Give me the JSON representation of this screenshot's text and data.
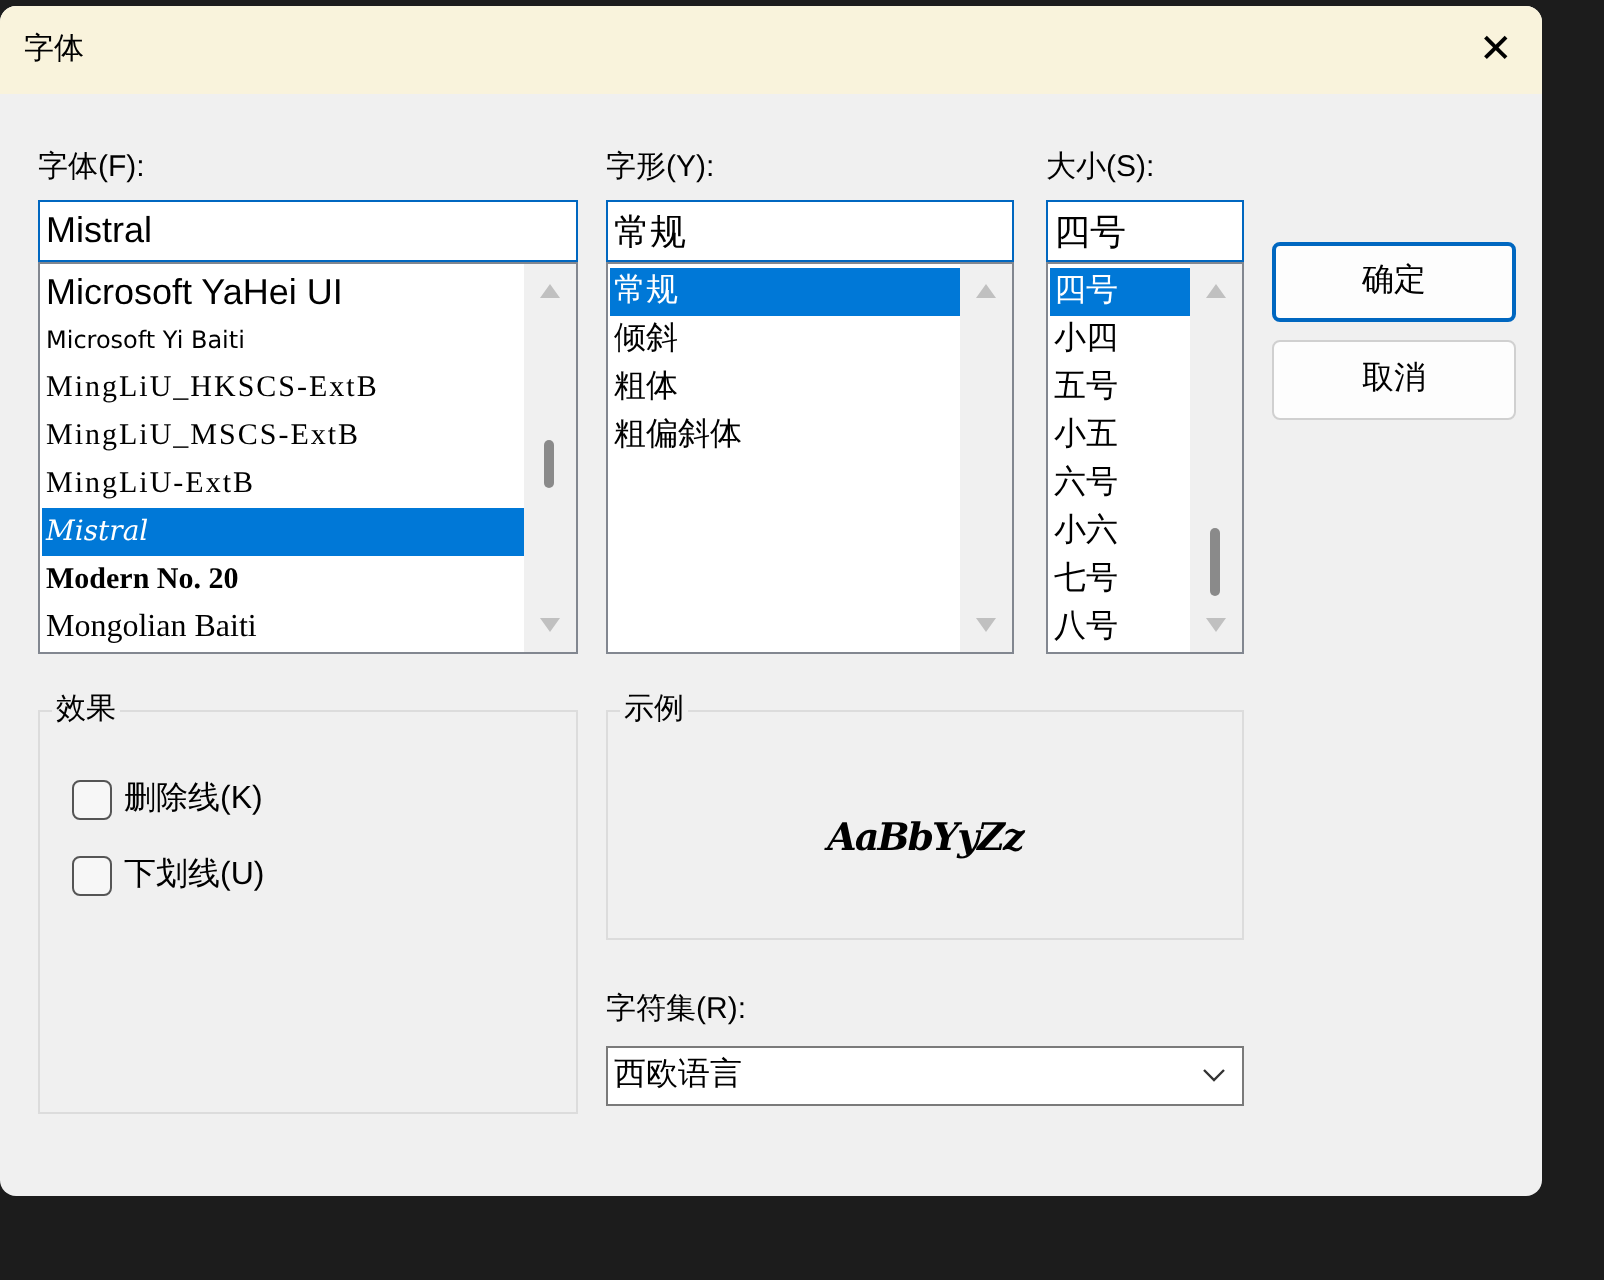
{
  "window": {
    "title": "字体",
    "close": "✕"
  },
  "font": {
    "label": "字体(F):",
    "value": "Mistral",
    "items": [
      {
        "label": "Microsoft YaHei UI",
        "kind": "sans",
        "selected": false
      },
      {
        "label": "Microsoft  Yi  Baiti",
        "kind": "small",
        "selected": false
      },
      {
        "label": "MingLiU_HKSCS-ExtB",
        "kind": "mono",
        "selected": false
      },
      {
        "label": "MingLiU_MSCS-ExtB",
        "kind": "mono",
        "selected": false
      },
      {
        "label": "MingLiU-ExtB",
        "kind": "mono",
        "selected": false
      },
      {
        "label": "Mistral",
        "kind": "script",
        "selected": true
      },
      {
        "label": "Modern No. 20",
        "kind": "bold",
        "selected": false
      },
      {
        "label": "Mongolian Baiti",
        "kind": "serif",
        "selected": false
      }
    ]
  },
  "style": {
    "label": "字形(Y):",
    "value": "常规",
    "items": [
      {
        "label": "常规",
        "selected": true
      },
      {
        "label": "倾斜",
        "selected": false
      },
      {
        "label": "粗体",
        "selected": false
      },
      {
        "label": "粗偏斜体",
        "selected": false
      }
    ]
  },
  "size": {
    "label": "大小(S):",
    "value": "四号",
    "items": [
      {
        "label": "四号",
        "selected": true
      },
      {
        "label": "小四",
        "selected": false
      },
      {
        "label": "五号",
        "selected": false
      },
      {
        "label": "小五",
        "selected": false
      },
      {
        "label": "六号",
        "selected": false
      },
      {
        "label": "小六",
        "selected": false
      },
      {
        "label": "七号",
        "selected": false
      },
      {
        "label": "八号",
        "selected": false
      }
    ]
  },
  "buttons": [
    {
      "label": "确定",
      "default": true
    },
    {
      "label": "取消",
      "default": false
    }
  ],
  "effects": {
    "title": "效果",
    "options": [
      {
        "label": "删除线(K)",
        "checked": false
      },
      {
        "label": "下划线(U)",
        "checked": false
      }
    ]
  },
  "sample": {
    "title": "示例",
    "text": "AaBbYyZz"
  },
  "charset": {
    "label": "字符集(R):",
    "value": "西欧语言"
  }
}
